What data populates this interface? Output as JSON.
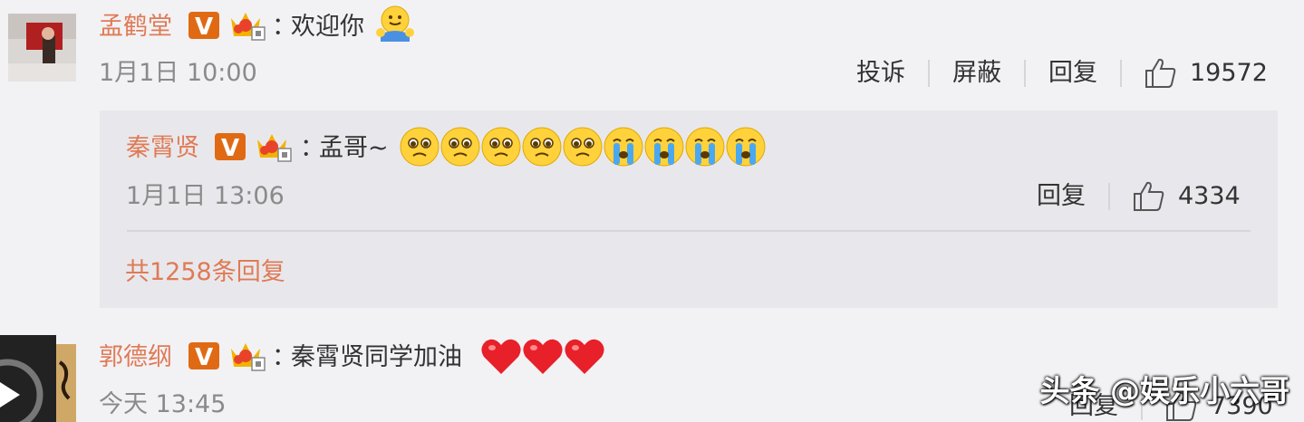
{
  "comments": [
    {
      "user": "孟鹤堂",
      "separator": "：",
      "text": "欢迎你",
      "emojis": [
        "hug-emoji"
      ],
      "time": "1月1日 10:00",
      "actions": [
        "投诉",
        "屏蔽",
        "回复"
      ],
      "likes": "19572"
    },
    {
      "user": "郭德纲",
      "separator": "：",
      "text": "秦霄贤同学加油",
      "emojis": [
        "heart-emoji",
        "heart-emoji",
        "heart-emoji"
      ],
      "time": "今天 13:45",
      "actions": [
        "回复"
      ],
      "likes": "7390"
    }
  ],
  "reply": {
    "user": "秦霄贤",
    "separator": "：",
    "text": "孟哥~",
    "emojis": [
      "pleading-emoji",
      "pleading-emoji",
      "pleading-emoji",
      "pleading-emoji",
      "pleading-emoji",
      "crying-emoji",
      "crying-emoji",
      "crying-emoji",
      "crying-emoji"
    ],
    "time": "1月1日 13:06",
    "actions": [
      "回复"
    ],
    "likes": "4334"
  },
  "more_replies": "共1258条回复",
  "watermark": "头条 @娱乐小六哥",
  "colors": {
    "name": "#e07a55",
    "badge_v": "#e06a14",
    "crown": "#f2b300",
    "background": "#f2f2f5",
    "reply_background": "#e8e8ec"
  }
}
